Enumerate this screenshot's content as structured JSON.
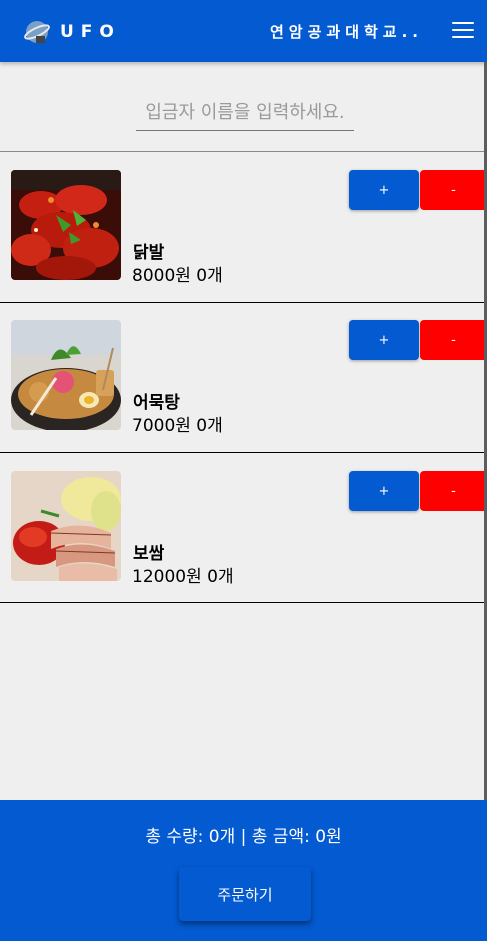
{
  "header": {
    "brand": "UFO",
    "school": "연암공과대학교..",
    "logo_icon": "planet-icon",
    "menu_icon": "hamburger-menu-icon"
  },
  "form": {
    "name_placeholder": "입금자 이름을 입력하세요.",
    "name_value": ""
  },
  "items": [
    {
      "name": "닭발",
      "price": 8000,
      "quantity": 0,
      "meta": "8000원 0개",
      "plus_label": "+",
      "minus_label": "-",
      "image": "spicy-chicken-feet-photo"
    },
    {
      "name": "어묵탕",
      "price": 7000,
      "quantity": 0,
      "meta": "7000원 0개",
      "plus_label": "+",
      "minus_label": "-",
      "image": "fish-cake-soup-photo"
    },
    {
      "name": "보쌈",
      "price": 12000,
      "quantity": 0,
      "meta": "12000원 0개",
      "plus_label": "+",
      "minus_label": "-",
      "image": "bossam-pork-photo"
    }
  ],
  "footer": {
    "total": "총 수량: 0개 | 총 금액: 0원",
    "order_label": "주문하기"
  },
  "colors": {
    "primary": "#035ad1",
    "danger": "#ff0000",
    "background": "#efefef"
  }
}
